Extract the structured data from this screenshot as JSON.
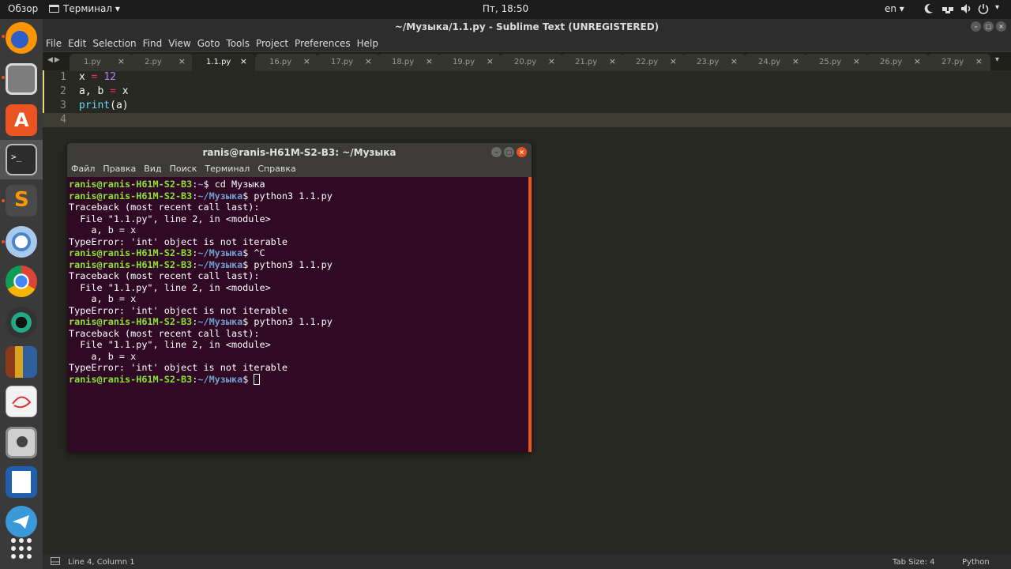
{
  "topbar": {
    "activities": "Обзор",
    "app_menu": "Терминал ▾",
    "clock": "Пт, 18:50",
    "lang": "en ▾"
  },
  "dock": {
    "items": [
      "firefox-icon",
      "files-icon",
      "software-center-icon",
      "terminal-icon",
      "sublime-text-icon",
      "chromium-icon",
      "chrome-icon",
      "camera-app-icon",
      "calibre-icon",
      "document-viewer-icon",
      "screenshot-icon",
      "writer-icon",
      "telegram-icon",
      "app-grid-icon"
    ]
  },
  "sublime": {
    "title": "~/Музыка/1.1.py - Sublime Text (UNREGISTERED)",
    "menu": [
      "File",
      "Edit",
      "Selection",
      "Find",
      "View",
      "Goto",
      "Tools",
      "Project",
      "Preferences",
      "Help"
    ],
    "tabs": [
      "1.py",
      "2.py",
      "1.1.py",
      "16.py",
      "17.py",
      "18.py",
      "19.py",
      "20.py",
      "21.py",
      "22.py",
      "23.py",
      "24.py",
      "25.py",
      "26.py",
      "27.py"
    ],
    "active_tab": "1.1.py",
    "tab_close": "×",
    "code": [
      {
        "n": "1",
        "text": "x = 12"
      },
      {
        "n": "2",
        "text": "a, b = x"
      },
      {
        "n": "3",
        "text": "print(a)"
      },
      {
        "n": "4",
        "text": ""
      }
    ],
    "status": {
      "position": "Line 4, Column 1",
      "tab_size": "Tab Size: 4",
      "syntax": "Python"
    }
  },
  "terminal": {
    "title": "ranis@ranis-H61M-S2-B3: ~/Музыка",
    "menu": [
      "Файл",
      "Правка",
      "Вид",
      "Поиск",
      "Терминал",
      "Справка"
    ],
    "user_host": "ranis@ranis-H61M-S2-B3",
    "lines": [
      {
        "type": "prompt",
        "path": "~",
        "cmd": "cd Музыка"
      },
      {
        "type": "prompt",
        "path": "~/Музыка",
        "cmd": "python3 1.1.py"
      },
      {
        "type": "out",
        "text": "Traceback (most recent call last):"
      },
      {
        "type": "out",
        "text": "  File \"1.1.py\", line 2, in <module>"
      },
      {
        "type": "out",
        "text": "    a, b = x"
      },
      {
        "type": "out",
        "text": "TypeError: 'int' object is not iterable"
      },
      {
        "type": "prompt",
        "path": "~/Музыка",
        "cmd": "^C"
      },
      {
        "type": "prompt",
        "path": "~/Музыка",
        "cmd": "python3 1.1.py"
      },
      {
        "type": "out",
        "text": "Traceback (most recent call last):"
      },
      {
        "type": "out",
        "text": "  File \"1.1.py\", line 2, in <module>"
      },
      {
        "type": "out",
        "text": "    a, b = x"
      },
      {
        "type": "out",
        "text": "TypeError: 'int' object is not iterable"
      },
      {
        "type": "prompt",
        "path": "~/Музыка",
        "cmd": "python3 1.1.py"
      },
      {
        "type": "out",
        "text": "Traceback (most recent call last):"
      },
      {
        "type": "out",
        "text": "  File \"1.1.py\", line 2, in <module>"
      },
      {
        "type": "out",
        "text": "    a, b = x"
      },
      {
        "type": "out",
        "text": "TypeError: 'int' object is not iterable"
      },
      {
        "type": "prompt",
        "path": "~/Музыка",
        "cmd": "",
        "cursor": true
      }
    ]
  },
  "colors": {
    "accent": "#e95420",
    "terminal_bg": "#300a24",
    "prompt_user": "#8ae234",
    "prompt_path": "#729fcf",
    "editor_bg": "#272822"
  }
}
